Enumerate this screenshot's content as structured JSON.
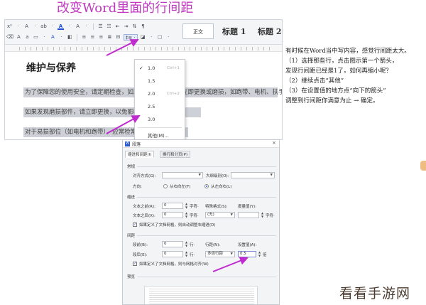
{
  "title": "改变Word里面的行间距",
  "toolbar": {
    "row1": [
      "ⅹ²",
      "·",
      "A",
      "·",
      "ab",
      "·",
      "A",
      "·",
      "A",
      "·"
    ],
    "row2_left": "≡",
    "line_spacing_btn": "‡≡ ·",
    "styles": {
      "normal": "正文",
      "h1": "标题 1",
      "h2": "标题 2"
    }
  },
  "document": {
    "heading": "维护与保养",
    "line1": "为了保障您的使用安全，请定期检查，如发现磨损部件，请立即更换或磨损，如跑带、电机、扶手等",
    "line2": "如果发现磨损部件，请立即更换，以免影响使用。",
    "line3": "对于易损部位（如电机和跑带），应常检常换。"
  },
  "line_spacing_menu": {
    "items": [
      {
        "value": "1.0",
        "shortcut": "Ctrl+1",
        "checked": true
      },
      {
        "value": "1.5",
        "shortcut": "",
        "checked": false
      },
      {
        "value": "2.0",
        "shortcut": "Ctrl+2",
        "checked": false
      },
      {
        "value": "2.5",
        "shortcut": "",
        "checked": false
      },
      {
        "value": "3.0",
        "shortcut": "",
        "checked": false
      }
    ],
    "other": "其他(M)..."
  },
  "explanation": {
    "l1": "有时候在Word当中写内容，感觉行间距太大。",
    "l2": "（1）选择那些行，点击图示第一个箭头，",
    "l3": "发现行间距已经是1了，如何再缩小呢？",
    "l4": "（2）继续点击“其他”",
    "l5": "（3）在设置值的地方点“向下的箭头”",
    "l6": "调整到行间距你满意为止 → 确定。"
  },
  "dialog": {
    "title": "段落",
    "tabs": [
      "缩进和间距(I)",
      "换行和分页(P)"
    ],
    "general": {
      "section": "常规",
      "alignment_label": "对齐方式(G):",
      "alignment_value": "",
      "outline_label": "大纲级别(O):",
      "outline_value": "",
      "direction_label": "方向:",
      "rtl": "从右向左(F)",
      "ltr": "从左向右(L)"
    },
    "indent": {
      "section": "缩进",
      "before_label": "文本之前(R):",
      "before_value": "0",
      "after_label": "文本之后(X):",
      "after_value": "0",
      "unit": "字符·",
      "special_label": "特殊格式(S):",
      "special_value": "(无)",
      "measure_label": "度量值(Y):",
      "measure_value": "",
      "grid_check": "如果定义了文档网格，则自动调整右缩进(D)"
    },
    "spacing": {
      "section": "间距",
      "before_label": "段前(B):",
      "before_value": "0",
      "after_label": "段后(E):",
      "after_value": "0",
      "unit": "行·",
      "line_label": "行距(N):",
      "line_value": "多倍行距",
      "setting_label": "设置值(A):",
      "setting_value": "0.5",
      "setting_unit": "倍",
      "grid_check": "如果定义了文档网格，则与网格对齐(W)"
    },
    "preview_label": "预览"
  },
  "watermark": "看看手游网",
  "colors": {
    "title": "#c039c0",
    "arrow": "#c02bd0",
    "selection": "#cdd0d6"
  }
}
